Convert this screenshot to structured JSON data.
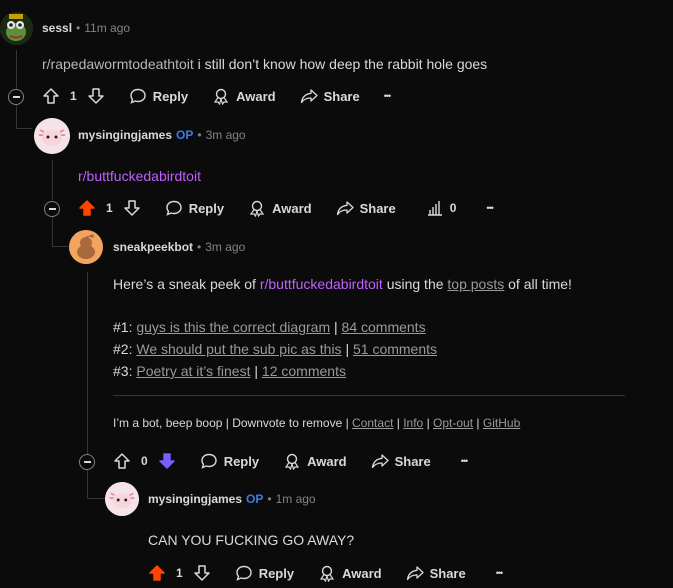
{
  "comments": [
    {
      "username": "sessl",
      "time": "11m ago",
      "body_sub": "r/rapedawormtodeathtoit",
      "body_text": " i still don’t know how deep the rabbit hole goes",
      "score": "1",
      "reply": "Reply",
      "award": "Award",
      "share": "Share",
      "more": "•••"
    },
    {
      "username": "mysingingjames",
      "op": "OP",
      "time": "3m ago",
      "body_sub": "r/buttfuckedabirdtoit",
      "score": "1",
      "reply": "Reply",
      "award": "Award",
      "share": "Share",
      "stats": "0",
      "more": "•••"
    },
    {
      "username": "sneakpeekbot",
      "time": "3m ago",
      "intro_a": "Here’s a sneak peek of ",
      "intro_sub": "r/buttfuckedabirdtoit",
      "intro_b": " using the ",
      "intro_link": "top posts",
      "intro_c": " of all time!",
      "posts": [
        {
          "label": "#1: ",
          "title": "guys is this the correct diagram",
          "comments": "84 comments"
        },
        {
          "label": "#2: ",
          "title": "We should put the sub pic as this",
          "comments": "51 comments"
        },
        {
          "label": "#3: ",
          "title": "Poetry at it’s finest",
          "comments": "12 comments"
        }
      ],
      "pipe": "|",
      "footer_text": "I’m a bot, beep boop | Downvote to remove | ",
      "footer_links": [
        "Contact",
        "Info",
        "Opt-out",
        "GitHub"
      ],
      "score": "0",
      "reply": "Reply",
      "award": "Award",
      "share": "Share",
      "more": "•••"
    },
    {
      "username": "mysingingjames",
      "op": "OP",
      "time": "1m ago",
      "body_text": "CAN YOU FUCKING GO AWAY?",
      "score": "1",
      "reply": "Reply",
      "award": "Award",
      "share": "Share",
      "more": "•••"
    }
  ],
  "colors": {
    "upvoted": "#ff4500",
    "downvoted": "#7a5cff",
    "op": "#3b7be8",
    "subreddit": "#c060ff"
  }
}
